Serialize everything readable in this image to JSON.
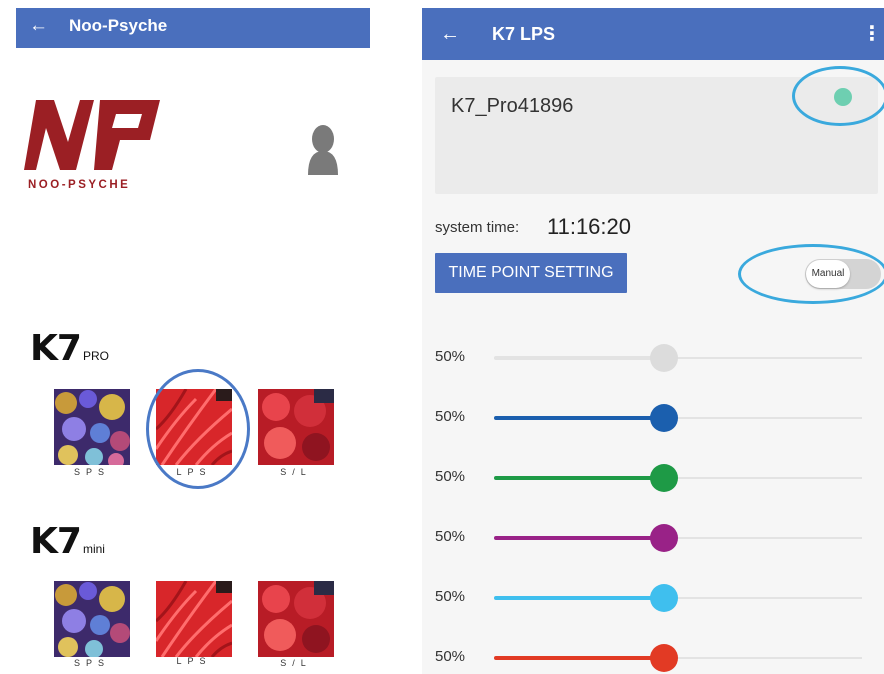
{
  "left_screen": {
    "back_icon": "arrow-left",
    "title": "Noo-Psyche",
    "logo_text": "NOO-PSYCHE",
    "sections": [
      {
        "brand": "K7",
        "variant": "PRO",
        "tiles": [
          {
            "label": "SPS",
            "image": "coral-reef-colorful"
          },
          {
            "label": "LPS",
            "image": "red-coral-closeup",
            "selected": true
          },
          {
            "label": "S/L",
            "image": "red-coral-reef"
          }
        ]
      },
      {
        "brand": "K7",
        "variant": "mini",
        "tiles": [
          {
            "label": "SPS",
            "image": "coral-reef-colorful"
          },
          {
            "label": "LPS",
            "image": "red-coral-closeup"
          },
          {
            "label": "S/L",
            "image": "red-coral-reef"
          }
        ]
      }
    ]
  },
  "right_screen": {
    "back_icon": "arrow-left",
    "title": "K7 LPS",
    "more_icon": "more-vertical",
    "device_name": "K7_Pro41896",
    "status_color": "#6ecfb1",
    "system_time_label": "system time:",
    "system_time_value": "11:16:20",
    "time_point_button": "TIME POINT SETTING",
    "mode_toggle_label": "Manual",
    "channels": [
      {
        "value_label": "50%",
        "value": 0.5,
        "color": "#dcdcdc"
      },
      {
        "value_label": "50%",
        "value": 0.5,
        "color": "#1b5fae"
      },
      {
        "value_label": "50%",
        "value": 0.5,
        "color": "#1e9a46"
      },
      {
        "value_label": "50%",
        "value": 0.5,
        "color": "#992287"
      },
      {
        "value_label": "50%",
        "value": 0.5,
        "color": "#3fbfee"
      },
      {
        "value_label": "50%",
        "value": 0.5,
        "color": "#e23a24"
      }
    ]
  },
  "colors": {
    "app_bar": "#4a6fbd",
    "highlight_ring": "#3aa9dd",
    "selection_ring": "#4a79c6",
    "logo_red": "#9b1f24"
  }
}
